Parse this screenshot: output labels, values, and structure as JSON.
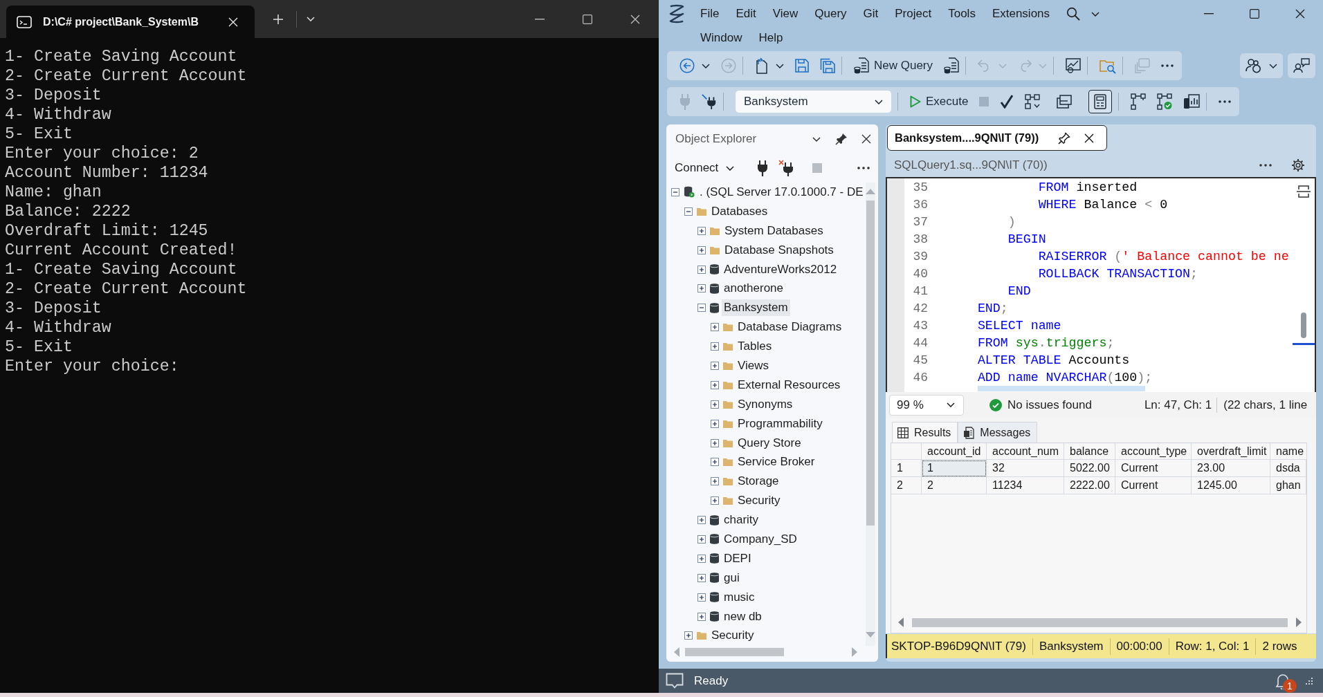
{
  "terminal": {
    "tab_title": "D:\\C# project\\Bank_System\\B",
    "lines": [
      "1- Create Saving Account",
      "2- Create Current Account",
      "3- Deposit",
      "4- Withdraw",
      "5- Exit",
      "Enter your choice: 2",
      "Account Number: 11234",
      "Name: ghan",
      "Balance: 2222",
      "Overdraft Limit: 1245",
      "Current Account Created!",
      "1- Create Saving Account",
      "2- Create Current Account",
      "3- Deposit",
      "4- Withdraw",
      "5- Exit",
      "Enter your choice:"
    ]
  },
  "ssms": {
    "menu_rows": [
      [
        "File",
        "Edit",
        "View",
        "Query",
        "Git",
        "Project",
        "Tools",
        "Extensions"
      ],
      [
        "Window",
        "Help"
      ]
    ],
    "standard_toolbar": {
      "groups": [
        [
          {
            "kind": "back",
            "disabled": false
          },
          {
            "kind": "caret",
            "disabled": false
          },
          {
            "kind": "forward",
            "disabled": true
          }
        ],
        [
          {
            "kind": "new_file",
            "disabled": false
          },
          {
            "kind": "caret",
            "disabled": false
          },
          {
            "kind": "save",
            "disabled": false
          },
          {
            "kind": "save_all",
            "disabled": false
          }
        ],
        [
          {
            "kind": "new_query",
            "label": "New Query",
            "disabled": false
          },
          {
            "kind": "script",
            "disabled": false
          }
        ],
        [
          {
            "kind": "undo",
            "disabled": true
          },
          {
            "kind": "caret",
            "disabled": true
          },
          {
            "kind": "redo",
            "disabled": true
          },
          {
            "kind": "caret",
            "disabled": true
          }
        ],
        [
          {
            "kind": "monitor",
            "disabled": false
          }
        ],
        [
          {
            "kind": "folder_search",
            "disabled": false
          }
        ],
        [
          {
            "kind": "window",
            "disabled": true
          },
          {
            "kind": "more",
            "disabled": false
          }
        ]
      ]
    },
    "side_toolbar": {
      "groups": [
        [
          {
            "kind": "people",
            "disabled": false
          },
          {
            "kind": "caret",
            "disabled": false
          }
        ],
        [
          {
            "kind": "feedback",
            "disabled": false
          }
        ]
      ]
    },
    "sql_toolbar": {
      "groups": [
        [
          {
            "kind": "plug",
            "disabled": true
          },
          {
            "kind": "change_connection",
            "disabled": false
          }
        ],
        [
          {
            "kind": "database",
            "label": "Banksystem",
            "disabled": false
          }
        ],
        [
          {
            "kind": "execute",
            "label": "Execute",
            "disabled": false
          },
          {
            "kind": "stop",
            "disabled": true
          },
          {
            "kind": "parse",
            "disabled": false
          },
          {
            "kind": "plan",
            "disabled": false
          },
          {
            "kind": "text_output",
            "disabled": false,
            "on": false
          },
          {
            "kind": "grid_output",
            "disabled": false,
            "on": true
          }
        ],
        [
          {
            "kind": "flow",
            "disabled": false
          },
          {
            "kind": "flow_check",
            "disabled": false
          },
          {
            "kind": "stats",
            "disabled": false
          }
        ],
        [
          {
            "kind": "more",
            "disabled": false
          }
        ]
      ]
    },
    "object_explorer": {
      "title": "Object Explorer",
      "connect": "Connect",
      "toolbar": [
        {
          "kind": "plug",
          "disabled": false
        },
        {
          "kind": "disconnect",
          "disabled": false
        },
        {
          "kind": "stop",
          "disabled": true
        },
        {
          "kind": "more",
          "disabled": false
        }
      ],
      "tree": [
        {
          "label": ". (SQL Server 17.0.1000.7 - DE",
          "kind": "server",
          "expanded": true,
          "selected": false,
          "children": [
            {
              "label": "Databases",
              "kind": "folder",
              "expanded": true,
              "selected": false,
              "children": [
                {
                  "label": "System Databases",
                  "kind": "folder",
                  "expanded": false,
                  "selected": false
                },
                {
                  "label": "Database Snapshots",
                  "kind": "folder",
                  "expanded": false,
                  "selected": false
                },
                {
                  "label": "AdventureWorks2012",
                  "kind": "database",
                  "expanded": false,
                  "selected": false
                },
                {
                  "label": "anotherone",
                  "kind": "database",
                  "expanded": false,
                  "selected": false
                },
                {
                  "label": "Banksystem",
                  "kind": "database",
                  "expanded": true,
                  "selected": true,
                  "children": [
                    {
                      "label": "Database Diagrams",
                      "kind": "folder",
                      "expanded": false,
                      "selected": false
                    },
                    {
                      "label": "Tables",
                      "kind": "folder",
                      "expanded": false,
                      "selected": false
                    },
                    {
                      "label": "Views",
                      "kind": "folder",
                      "expanded": false,
                      "selected": false
                    },
                    {
                      "label": "External Resources",
                      "kind": "folder",
                      "expanded": false,
                      "selected": false
                    },
                    {
                      "label": "Synonyms",
                      "kind": "folder",
                      "expanded": false,
                      "selected": false
                    },
                    {
                      "label": "Programmability",
                      "kind": "folder",
                      "expanded": false,
                      "selected": false
                    },
                    {
                      "label": "Query Store",
                      "kind": "folder",
                      "expanded": false,
                      "selected": false
                    },
                    {
                      "label": "Service Broker",
                      "kind": "folder",
                      "expanded": false,
                      "selected": false
                    },
                    {
                      "label": "Storage",
                      "kind": "folder",
                      "expanded": false,
                      "selected": false
                    },
                    {
                      "label": "Security",
                      "kind": "folder",
                      "expanded": false,
                      "selected": false
                    }
                  ]
                },
                {
                  "label": "charity",
                  "kind": "database",
                  "expanded": false,
                  "selected": false
                },
                {
                  "label": "Company_SD",
                  "kind": "database",
                  "expanded": false,
                  "selected": false
                },
                {
                  "label": "DEPI",
                  "kind": "database",
                  "expanded": false,
                  "selected": false
                },
                {
                  "label": "gui",
                  "kind": "database",
                  "expanded": false,
                  "selected": false
                },
                {
                  "label": "music",
                  "kind": "database",
                  "expanded": false,
                  "selected": false
                },
                {
                  "label": "new db",
                  "kind": "database",
                  "expanded": false,
                  "selected": false
                }
              ]
            },
            {
              "label": "Security",
              "kind": "folder",
              "expanded": false,
              "selected": false
            }
          ]
        }
      ]
    },
    "editor": {
      "tabs": [
        {
          "label": "Banksystem....9QN\\IT (79))",
          "selected": true
        },
        {
          "label": "SQLQuery1.sq...9QN\\IT (70))",
          "selected": false
        }
      ],
      "lines": [
        {
          "number": "35",
          "tokens": [
            {
              "kind": "keyword",
              "text": "            FROM"
            },
            {
              "kind": "plain",
              "text": " inserted"
            }
          ]
        },
        {
          "number": "36",
          "tokens": [
            {
              "kind": "keyword",
              "text": "            WHERE"
            },
            {
              "kind": "plain",
              "text": " Balance "
            },
            {
              "kind": "operator",
              "text": "<"
            },
            {
              "kind": "plain",
              "text": " 0"
            }
          ]
        },
        {
          "number": "37",
          "tokens": [
            {
              "kind": "operator",
              "text": "        )"
            }
          ]
        },
        {
          "number": "38",
          "tokens": [
            {
              "kind": "keyword",
              "text": "        BEGIN"
            }
          ]
        },
        {
          "number": "39",
          "tokens": [
            {
              "kind": "keyword",
              "text": "            RAISERROR "
            },
            {
              "kind": "operator",
              "text": "("
            },
            {
              "kind": "string",
              "text": "' Balance cannot be ne"
            }
          ]
        },
        {
          "number": "40",
          "tokens": [
            {
              "kind": "keyword",
              "text": "            ROLLBACK TRANSACTION"
            },
            {
              "kind": "operator",
              "text": ";"
            }
          ]
        },
        {
          "number": "41",
          "tokens": [
            {
              "kind": "keyword",
              "text": "        END"
            }
          ]
        },
        {
          "number": "42",
          "tokens": [
            {
              "kind": "keyword",
              "text": "    END"
            },
            {
              "kind": "operator",
              "text": ";"
            }
          ]
        },
        {
          "number": "43",
          "tokens": [
            {
              "kind": "keyword",
              "text": "    SELECT name"
            }
          ]
        },
        {
          "number": "44",
          "tokens": [
            {
              "kind": "keyword",
              "text": "    FROM "
            },
            {
              "kind": "system",
              "text": "sys"
            },
            {
              "kind": "operator",
              "text": "."
            },
            {
              "kind": "system",
              "text": "triggers"
            },
            {
              "kind": "operator",
              "text": ";"
            }
          ]
        },
        {
          "number": "45",
          "tokens": [
            {
              "kind": "keyword",
              "text": "    ALTER TABLE"
            },
            {
              "kind": "plain",
              "text": " Accounts"
            }
          ]
        },
        {
          "number": "46",
          "tokens": [
            {
              "kind": "keyword",
              "text": "    ADD name NVARCHAR"
            },
            {
              "kind": "operator",
              "text": "("
            },
            {
              "kind": "plain",
              "text": "100"
            },
            {
              "kind": "operator",
              "text": ");"
            }
          ]
        }
      ],
      "zoom": "99 %",
      "issues": "No issues found",
      "position": "Ln: 47, Ch: 1",
      "selection": "(22 chars, 1 line"
    },
    "results": {
      "tabs": [
        {
          "label": "Results",
          "kind": "grid",
          "selected": true
        },
        {
          "label": "Messages",
          "kind": "messages",
          "selected": false
        }
      ],
      "columns": [
        "account_id",
        "account_num",
        "balance",
        "account_type",
        "overdraft_limit",
        "name"
      ],
      "rows": [
        {
          "number": "1",
          "cells": [
            {
              "text": "1",
              "selected": true
            },
            {
              "text": "32",
              "selected": false
            },
            {
              "text": "5022.00",
              "selected": false
            },
            {
              "text": "Current",
              "selected": false
            },
            {
              "text": "23.00",
              "selected": false
            },
            {
              "text": "dsda",
              "selected": false
            }
          ]
        },
        {
          "number": "2",
          "cells": [
            {
              "text": "2",
              "selected": false
            },
            {
              "text": "11234",
              "selected": false
            },
            {
              "text": "2222.00",
              "selected": false
            },
            {
              "text": "Current",
              "selected": false
            },
            {
              "text": "1245.00",
              "selected": false
            },
            {
              "text": "ghan",
              "selected": false
            }
          ]
        }
      ]
    },
    "query_status": {
      "server": "SKTOP-B96D9QN\\IT (79)",
      "database": "Banksystem",
      "elapsed": "00:00:00",
      "position": "Row: 1, Col: 1",
      "rows": "2 rows"
    },
    "status_bar": {
      "text": "Ready",
      "notifications": "1"
    }
  }
}
